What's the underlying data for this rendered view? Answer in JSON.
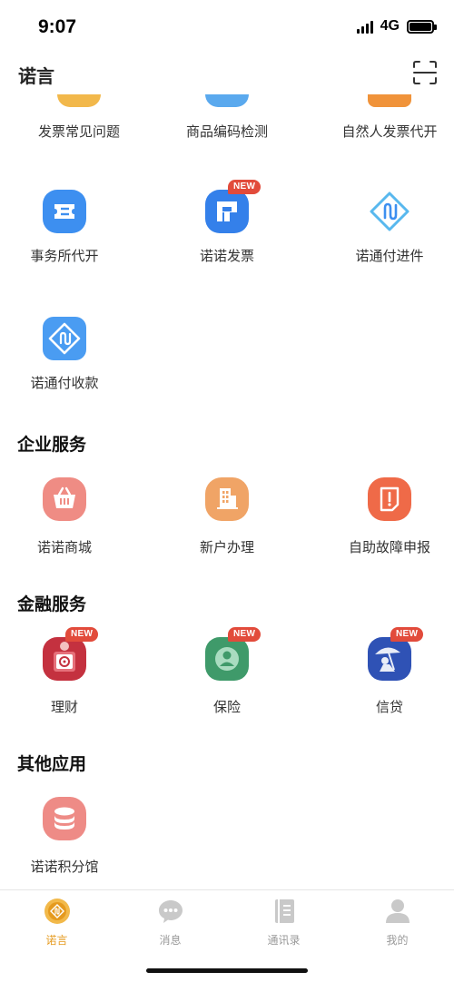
{
  "status_bar": {
    "time": "9:07",
    "network": "4G"
  },
  "header": {
    "title": "诺言"
  },
  "top_items": [
    {
      "label": "发票常见问题",
      "color": "#f2b84b"
    },
    {
      "label": "商品编码检测",
      "color": "#5aa9ee"
    },
    {
      "label": "自然人发票代开",
      "color": "#f0933a"
    }
  ],
  "service_items": [
    {
      "label": "事务所代开",
      "icon": "ticket-icon"
    },
    {
      "label": "诺诺发票",
      "icon": "invoice-icon",
      "badge": "NEW"
    },
    {
      "label": "诺通付进件",
      "icon": "nuotongfu-icon"
    },
    {
      "label": "诺通付收款",
      "icon": "payment-icon"
    }
  ],
  "sections": {
    "enterprise": {
      "title": "企业服务",
      "items": [
        {
          "label": "诺诺商城",
          "icon": "basket-icon"
        },
        {
          "label": "新户办理",
          "icon": "building-icon"
        },
        {
          "label": "自助故障申报",
          "icon": "report-icon"
        }
      ]
    },
    "finance": {
      "title": "金融服务",
      "items": [
        {
          "label": "理财",
          "icon": "safe-icon",
          "badge": "NEW"
        },
        {
          "label": "保险",
          "icon": "insurance-icon",
          "badge": "NEW"
        },
        {
          "label": "信贷",
          "icon": "loan-icon",
          "badge": "NEW"
        }
      ]
    },
    "other": {
      "title": "其他应用",
      "items": [
        {
          "label": "诺诺积分馆",
          "icon": "points-icon"
        }
      ]
    }
  },
  "tabbar": [
    {
      "label": "诺言",
      "icon": "nuoyan-icon",
      "active": true
    },
    {
      "label": "消息",
      "icon": "message-icon",
      "active": false
    },
    {
      "label": "通讯录",
      "icon": "contacts-icon",
      "active": false
    },
    {
      "label": "我的",
      "icon": "profile-icon",
      "active": false
    }
  ],
  "colors": {
    "accent": "#e59a1e",
    "badge": "#e24b3b"
  }
}
